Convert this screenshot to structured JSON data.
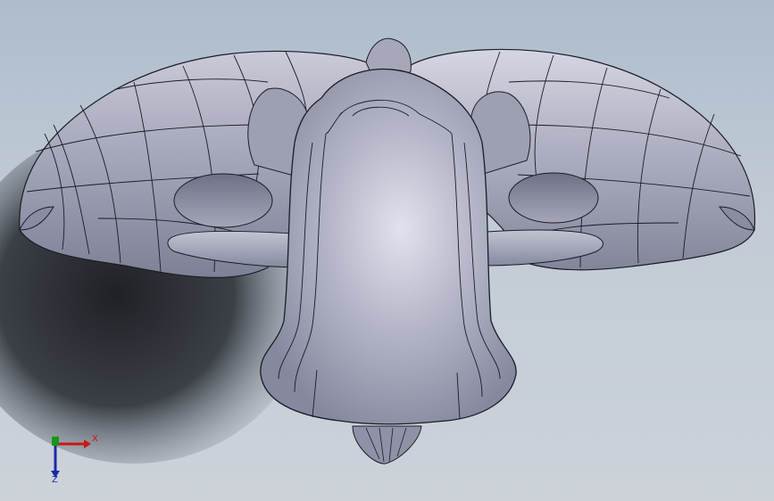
{
  "viewport": {
    "background_top": "#aebccc",
    "background_bottom": "#ccd2d8",
    "model_color": "#9ea0b4",
    "edge_color": "#1c1c26",
    "shadow_color": "#2a2e34"
  },
  "triad": {
    "x_label": "X",
    "y_label": "Y",
    "z_label": "Z",
    "x_color": "#c81818",
    "y_color": "#169616",
    "z_color": "#1a2aa8"
  }
}
